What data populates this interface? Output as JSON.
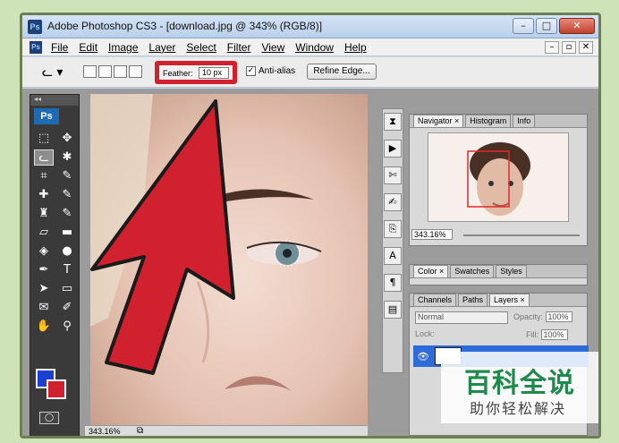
{
  "window": {
    "logo": "Ps",
    "title": "Adobe Photoshop CS3 - [download.jpg @ 343% (RGB/8)]",
    "controls": [
      "–",
      "□",
      "✕"
    ]
  },
  "menubar": {
    "logo": "Ps",
    "items": [
      "File",
      "Edit",
      "Image",
      "Layer",
      "Select",
      "Filter",
      "View",
      "Window",
      "Help"
    ],
    "doc_controls": [
      "–",
      "▫",
      "✕"
    ]
  },
  "options": {
    "feather_label": "Feather:",
    "feather_value": "10 px",
    "antialias_label": "Anti-alias",
    "antialias_check": "✓",
    "refine_label": "Refine Edge..."
  },
  "toolbox": {
    "logo": "Ps",
    "tools": [
      {
        "icon": "marquee-icon",
        "glyph": "⬚"
      },
      {
        "icon": "move-icon",
        "glyph": "✥"
      },
      {
        "icon": "lasso-icon",
        "glyph": "ᓚ"
      },
      {
        "icon": "magic-wand-icon",
        "glyph": "✱"
      },
      {
        "icon": "crop-icon",
        "glyph": "⌗"
      },
      {
        "icon": "slice-icon",
        "glyph": "✎"
      },
      {
        "icon": "healing-icon",
        "glyph": "✚"
      },
      {
        "icon": "brush-icon",
        "glyph": "✎"
      },
      {
        "icon": "stamp-icon",
        "glyph": "♜"
      },
      {
        "icon": "history-brush-icon",
        "glyph": "✎"
      },
      {
        "icon": "eraser-icon",
        "glyph": "▱"
      },
      {
        "icon": "gradient-icon",
        "glyph": "▬"
      },
      {
        "icon": "blur-icon",
        "glyph": "◈"
      },
      {
        "icon": "dodge-icon",
        "glyph": "●"
      },
      {
        "icon": "pen-icon",
        "glyph": "✒"
      },
      {
        "icon": "type-icon",
        "glyph": "T"
      },
      {
        "icon": "path-select-icon",
        "glyph": "➤"
      },
      {
        "icon": "shape-icon",
        "glyph": "▭"
      },
      {
        "icon": "notes-icon",
        "glyph": "✉"
      },
      {
        "icon": "eyedropper-icon",
        "glyph": "✐"
      },
      {
        "icon": "hand-icon",
        "glyph": "✋"
      },
      {
        "icon": "zoom-icon",
        "glyph": "⚲"
      }
    ],
    "quickmask": "◯"
  },
  "canvas": {
    "zoom": "343.16%",
    "status_icon": "⧉"
  },
  "navigator": {
    "tabs": [
      "Navigator ×",
      "Histogram",
      "Info"
    ],
    "zoom": "343.16%"
  },
  "swatches": {
    "tabs": [
      "Color ×",
      "Swatches",
      "Styles"
    ]
  },
  "layers": {
    "tabs": [
      "Channels",
      "Paths",
      "Layers ×"
    ],
    "blend_mode": "Normal",
    "opacity_label": "Opacity:",
    "opacity_value": "100%",
    "lock_label": "Lock:",
    "fill_label": "Fill:",
    "fill_value": "100%",
    "eye": "👁"
  },
  "watermark": {
    "main": "百科全说",
    "sub": "助你轻松解决"
  },
  "colors": {
    "arrow_red": "#d1202e",
    "foreground": "#1a3fd1",
    "background": "#d1202e",
    "layer_selected": "#2f6bd8"
  }
}
